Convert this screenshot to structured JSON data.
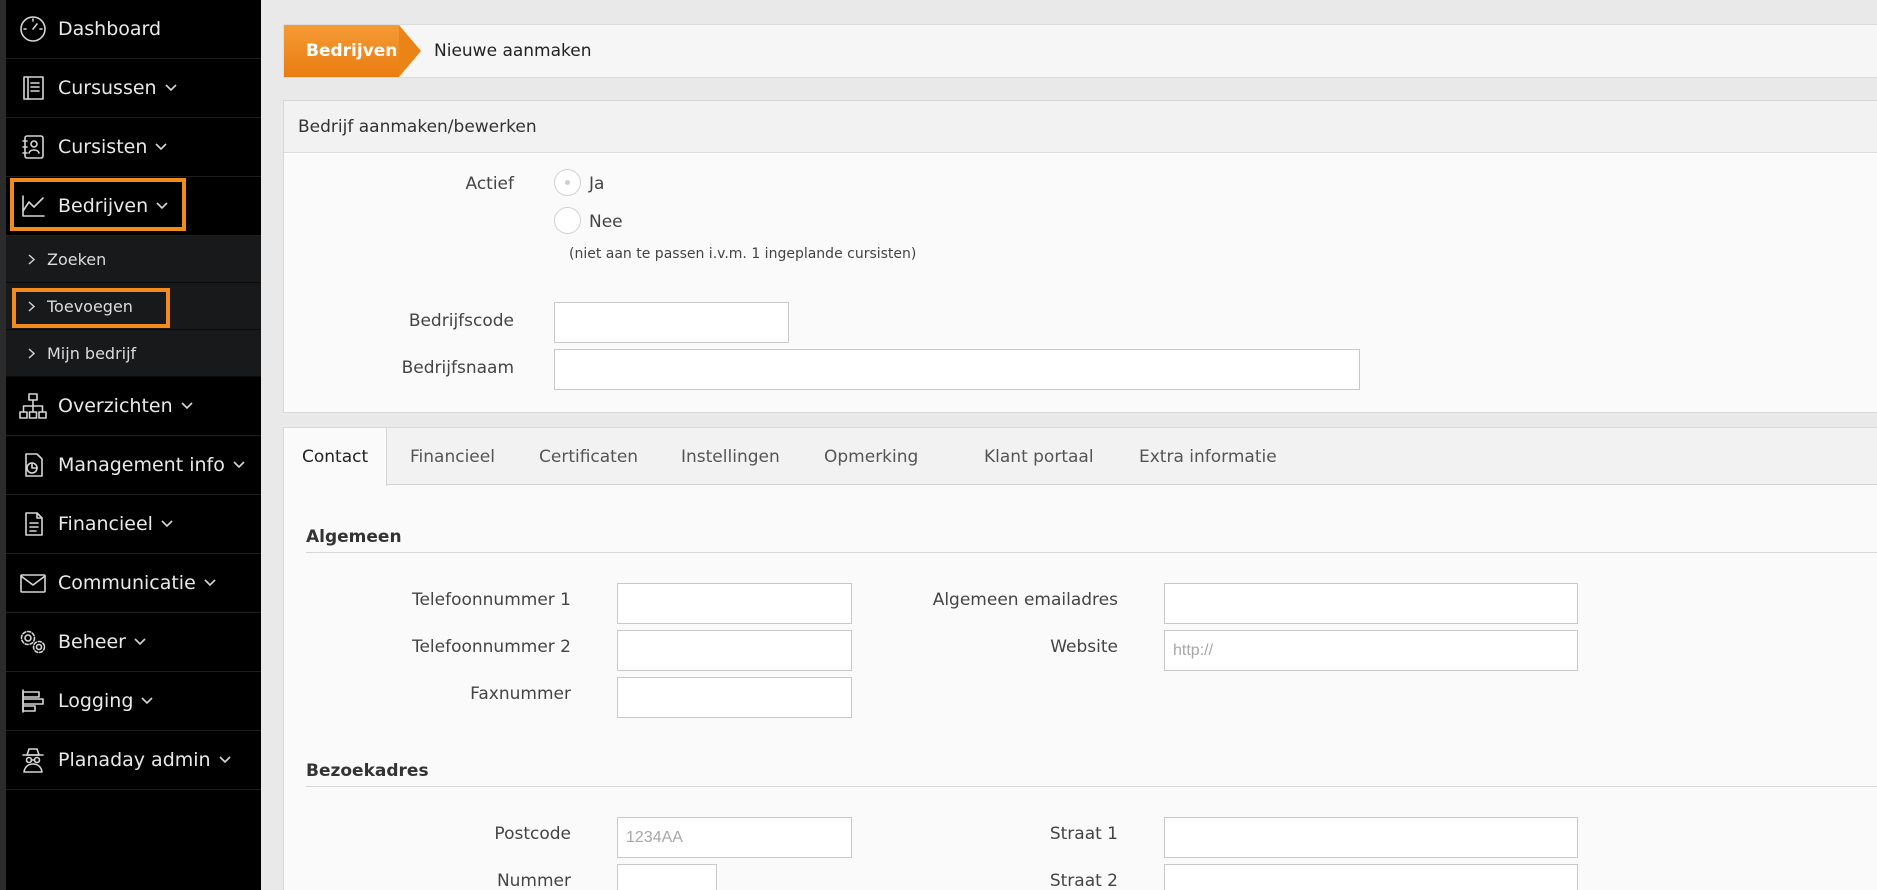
{
  "sidebar": {
    "items": [
      {
        "label": "Dashboard",
        "icon": "dashboard-gauge-icon",
        "chevron": false
      },
      {
        "label": "Cursussen",
        "icon": "book-icon",
        "chevron": true
      },
      {
        "label": "Cursisten",
        "icon": "contact-book-icon",
        "chevron": true
      },
      {
        "label": "Bedrijven",
        "icon": "company-chart-icon",
        "chevron": true
      },
      {
        "label": "Overzichten",
        "icon": "org-chart-icon",
        "chevron": true
      },
      {
        "label": "Management info",
        "icon": "pie-document-icon",
        "chevron": true
      },
      {
        "label": "Financieel",
        "icon": "document-lines-icon",
        "chevron": true
      },
      {
        "label": "Communicatie",
        "icon": "envelope-icon",
        "chevron": true
      },
      {
        "label": "Beheer",
        "icon": "gears-icon",
        "chevron": true
      },
      {
        "label": "Logging",
        "icon": "log-bars-icon",
        "chevron": true
      },
      {
        "label": "Planaday admin",
        "icon": "spy-icon",
        "chevron": true
      }
    ],
    "bedrijven_sub": [
      {
        "label": "Zoeken"
      },
      {
        "label": "Toevoegen"
      },
      {
        "label": "Mijn bedrijf"
      }
    ],
    "highlight_color": "#f28a1e"
  },
  "breadcrumb": {
    "section": "Bedrijven",
    "current": "Nieuwe aanmaken"
  },
  "form": {
    "title": "Bedrijf aanmaken/bewerken",
    "actief_label": "Actief",
    "radio_ja": "Ja",
    "radio_nee": "Nee",
    "note": "(niet aan te passen i.v.m. 1 ingeplande cursisten)",
    "bedrijfscode_label": "Bedrijfscode",
    "bedrijfsnaam_label": "Bedrijfsnaam"
  },
  "tabs": [
    {
      "label": "Contact",
      "active": true
    },
    {
      "label": "Financieel",
      "active": false
    },
    {
      "label": "Certificaten",
      "active": false
    },
    {
      "label": "Instellingen",
      "active": false
    },
    {
      "label": "Opmerking",
      "active": false
    },
    {
      "label": "Klant portaal",
      "active": false
    },
    {
      "label": "Extra informatie",
      "active": false
    }
  ],
  "contact": {
    "algemeen_title": "Algemeen",
    "telefoon1_label": "Telefoonnummer 1",
    "telefoon2_label": "Telefoonnummer 2",
    "fax_label": "Faxnummer",
    "email_label": "Algemeen emailadres",
    "website_label": "Website",
    "website_placeholder": "http://",
    "bezoek_title": "Bezoekadres",
    "postcode_label": "Postcode",
    "postcode_placeholder": "1234AA",
    "nummer_label": "Nummer",
    "straat1_label": "Straat 1",
    "straat2_label": "Straat 2"
  },
  "accent": "#ef8a1f"
}
